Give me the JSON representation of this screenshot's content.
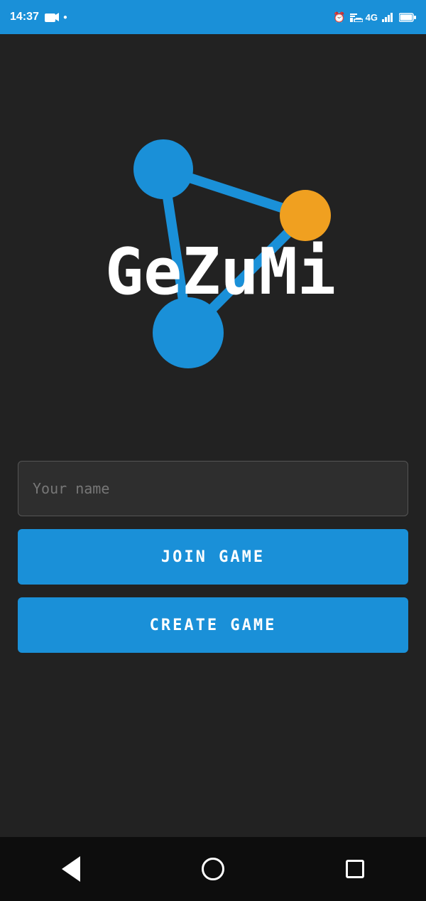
{
  "statusBar": {
    "time": "14:37",
    "leftIcons": [
      "camera-icon",
      "dot-icon"
    ],
    "rightIcons": [
      "alarm-icon",
      "cast-icon",
      "4g-icon",
      "signal-icon",
      "battery-icon"
    ]
  },
  "logo": {
    "appName": "GeZuMi",
    "colors": {
      "blue": "#1a90d8",
      "orange": "#f0a020",
      "dark": "#222222"
    }
  },
  "form": {
    "namePlaceholder": "Your name",
    "nameValue": ""
  },
  "buttons": {
    "joinLabel": "JOIN GAME",
    "createLabel": "CREATE GAME"
  },
  "navbar": {
    "back": "back-icon",
    "home": "home-icon",
    "recents": "recents-icon"
  }
}
